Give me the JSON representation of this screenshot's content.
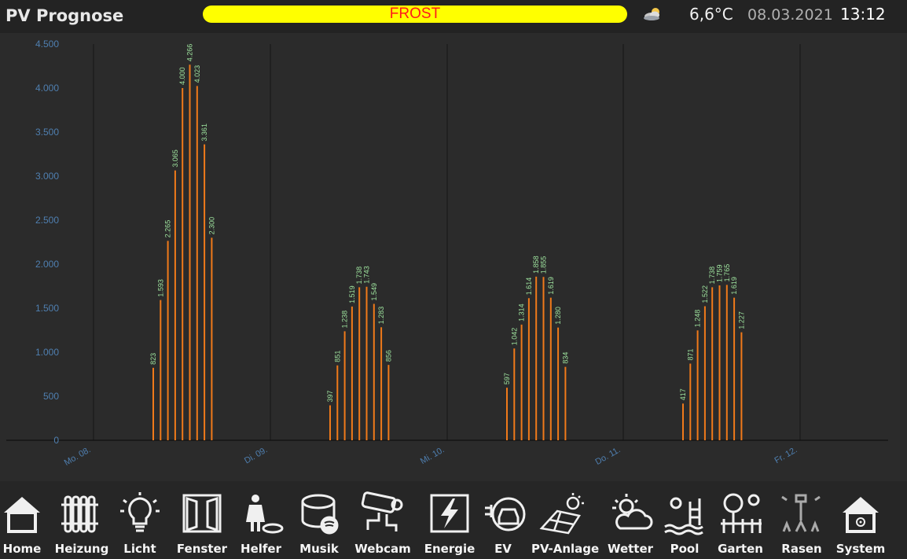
{
  "header": {
    "title": "PV Prognose",
    "status": "FROST",
    "weather_icon": "cloud-sun-icon",
    "temperature": "6,6°C",
    "date": "08.03.2021",
    "time": "13:12",
    "colors": {
      "status_bg": "#ffff00",
      "status_text": "#ff1a1a"
    }
  },
  "chart_data": {
    "type": "bar",
    "ylim": [
      0,
      4500
    ],
    "y_ticks": [
      "0",
      "500",
      "1.000",
      "1.500",
      "2.000",
      "2.500",
      "3.000",
      "3.500",
      "4.000",
      "4.500"
    ],
    "x_ticks": [
      "Mo. 08.",
      "Di. 09.",
      "Mi. 10.",
      "Do. 11.",
      "Fr. 12."
    ],
    "grid": "vertical",
    "bar_color": "#f07a1a",
    "label_color": "#9fe59f",
    "days": [
      {
        "day": "Mo. 08.",
        "values": [
          823,
          1593,
          2265,
          3065,
          4000,
          4266,
          4023,
          3361,
          2300
        ],
        "labels": [
          "823",
          "1.593",
          "2.265",
          "3.065",
          "4.000",
          "4.266",
          "4.023",
          "3.361",
          "2.300"
        ]
      },
      {
        "day": "Di. 09.",
        "values": [
          397,
          851,
          1238,
          1519,
          1738,
          1743,
          1549,
          1283,
          856
        ],
        "labels": [
          "397",
          "851",
          "1.238",
          "1.519",
          "1.738",
          "1.743",
          "1.549",
          "1.283",
          "856"
        ]
      },
      {
        "day": "Mi. 10.",
        "values": [
          597,
          1042,
          1314,
          1614,
          1858,
          1855,
          1619,
          1280,
          834
        ],
        "labels": [
          "597",
          "1.042",
          "1.314",
          "1.614",
          "1.858",
          "1.855",
          "1.619",
          "1.280",
          "834"
        ]
      },
      {
        "day": "Do. 11.",
        "values": [
          417,
          871,
          1248,
          1522,
          1738,
          1759,
          1765,
          1619,
          1227
        ],
        "labels": [
          "417",
          "871",
          "1.248",
          "1.522",
          "1.738",
          "1.759",
          "1.765",
          "1.619",
          "1.227"
        ]
      }
    ]
  },
  "nav": {
    "items": [
      {
        "label": "Home",
        "icon": "house-icon"
      },
      {
        "label": "Heizung",
        "icon": "radiator-icon"
      },
      {
        "label": "Licht",
        "icon": "lightbulb-icon"
      },
      {
        "label": "Fenster",
        "icon": "window-icon"
      },
      {
        "label": "Helfer",
        "icon": "helper-robot-icon"
      },
      {
        "label": "Musik",
        "icon": "speaker-icon"
      },
      {
        "label": "Webcam",
        "icon": "camera-icon"
      },
      {
        "label": "Energie",
        "icon": "energy-icon"
      },
      {
        "label": "EV",
        "icon": "electric-car-icon"
      },
      {
        "label": "PV-Anlage",
        "icon": "solar-panel-icon"
      },
      {
        "label": "Wetter",
        "icon": "weather-icon"
      },
      {
        "label": "Pool",
        "icon": "pool-icon"
      },
      {
        "label": "Garten",
        "icon": "garden-icon"
      },
      {
        "label": "Rasen",
        "icon": "sprinkler-icon"
      },
      {
        "label": "System",
        "icon": "system-house-icon"
      }
    ]
  }
}
